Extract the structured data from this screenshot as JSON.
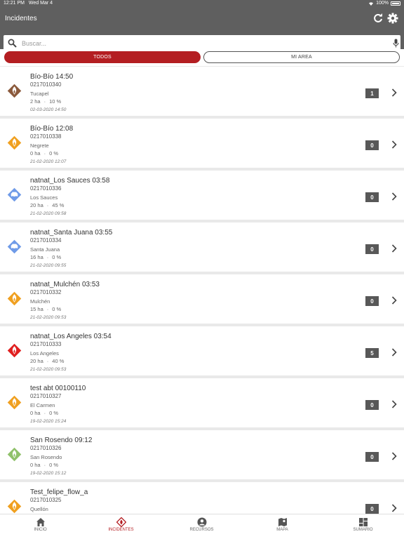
{
  "status": {
    "time": "12:21 PM",
    "date": "Wed Mar 4",
    "battery": "100%"
  },
  "nav": {
    "title": "Incidentes"
  },
  "search": {
    "placeholder": "Buscar..."
  },
  "segments": {
    "all": "TODOS",
    "area": "MI AREA",
    "selected": "TODOS"
  },
  "colors": {
    "accent": "#b41e22",
    "bar": "#5f5f5f"
  },
  "incidents": [
    {
      "name": "Bío-Bío 14:50",
      "code": "0217010340",
      "place": "Tucapel",
      "area": "2 ha",
      "pct": "10 %",
      "date": "02-03-2020 14:50",
      "count": "1",
      "color": "#8b5a3c",
      "icon": "fire-icon"
    },
    {
      "name": "Bío-Bío 12:08",
      "code": "0217010338",
      "place": "Negrete",
      "area": "0 ha",
      "pct": "0 %",
      "date": "21-02-2020 12:07",
      "count": "0",
      "color": "#f0a020",
      "icon": "fire-icon"
    },
    {
      "name": "natnat_Los Sauces 03:58",
      "code": "0217010336",
      "place": "Los Sauces",
      "area": "20 ha",
      "pct": "45 %",
      "date": "21-02-2020 09:58",
      "count": "0",
      "color": "#6f9be8",
      "icon": "vehicle-icon"
    },
    {
      "name": "natnat_Santa Juana 03:55",
      "code": "0217010334",
      "place": "Santa Juana",
      "area": "16 ha",
      "pct": "0 %",
      "date": "21-02-2020 09:55",
      "count": "0",
      "color": "#6f9be8",
      "icon": "vehicle-icon"
    },
    {
      "name": "natnat_Mulchén 03:53",
      "code": "0217010332",
      "place": "Mulchén",
      "area": "15 ha",
      "pct": "0 %",
      "date": "21-02-2020 09:53",
      "count": "0",
      "color": "#f0a020",
      "icon": "fire-icon"
    },
    {
      "name": "natnat_Los Angeles 03:54",
      "code": "0217010333",
      "place": "Los Angeles",
      "area": "20 ha",
      "pct": "40 %",
      "date": "21-02-2020 09:53",
      "count": "5",
      "color": "#e02020",
      "icon": "fire-icon"
    },
    {
      "name": "test abt 00100110",
      "code": "0217010327",
      "place": "El Carmen",
      "area": "0 ha",
      "pct": "0 %",
      "date": "19-02-2020 15:24",
      "count": "0",
      "color": "#f0a020",
      "icon": "fire-icon"
    },
    {
      "name": "San Rosendo 09:12",
      "code": "0217010326",
      "place": "San Rosendo",
      "area": "0 ha",
      "pct": "0 %",
      "date": "19-02-2020 15:12",
      "count": "0",
      "color": "#8fc16a",
      "icon": "fire-icon"
    },
    {
      "name": "Test_felipe_flow_a",
      "code": "0217010325",
      "place": "Quellón",
      "area": "",
      "pct": "",
      "date": "",
      "count": "0",
      "color": "#f0a020",
      "icon": "fire-icon"
    }
  ],
  "tabs": [
    {
      "label": "INICIO",
      "icon": "home-icon"
    },
    {
      "label": "INCIDENTES",
      "icon": "fire-icon"
    },
    {
      "label": "RECURSOS",
      "icon": "person-icon"
    },
    {
      "label": "MAPA",
      "icon": "map-icon"
    },
    {
      "label": "SUMARIO",
      "icon": "dashboard-icon"
    }
  ]
}
